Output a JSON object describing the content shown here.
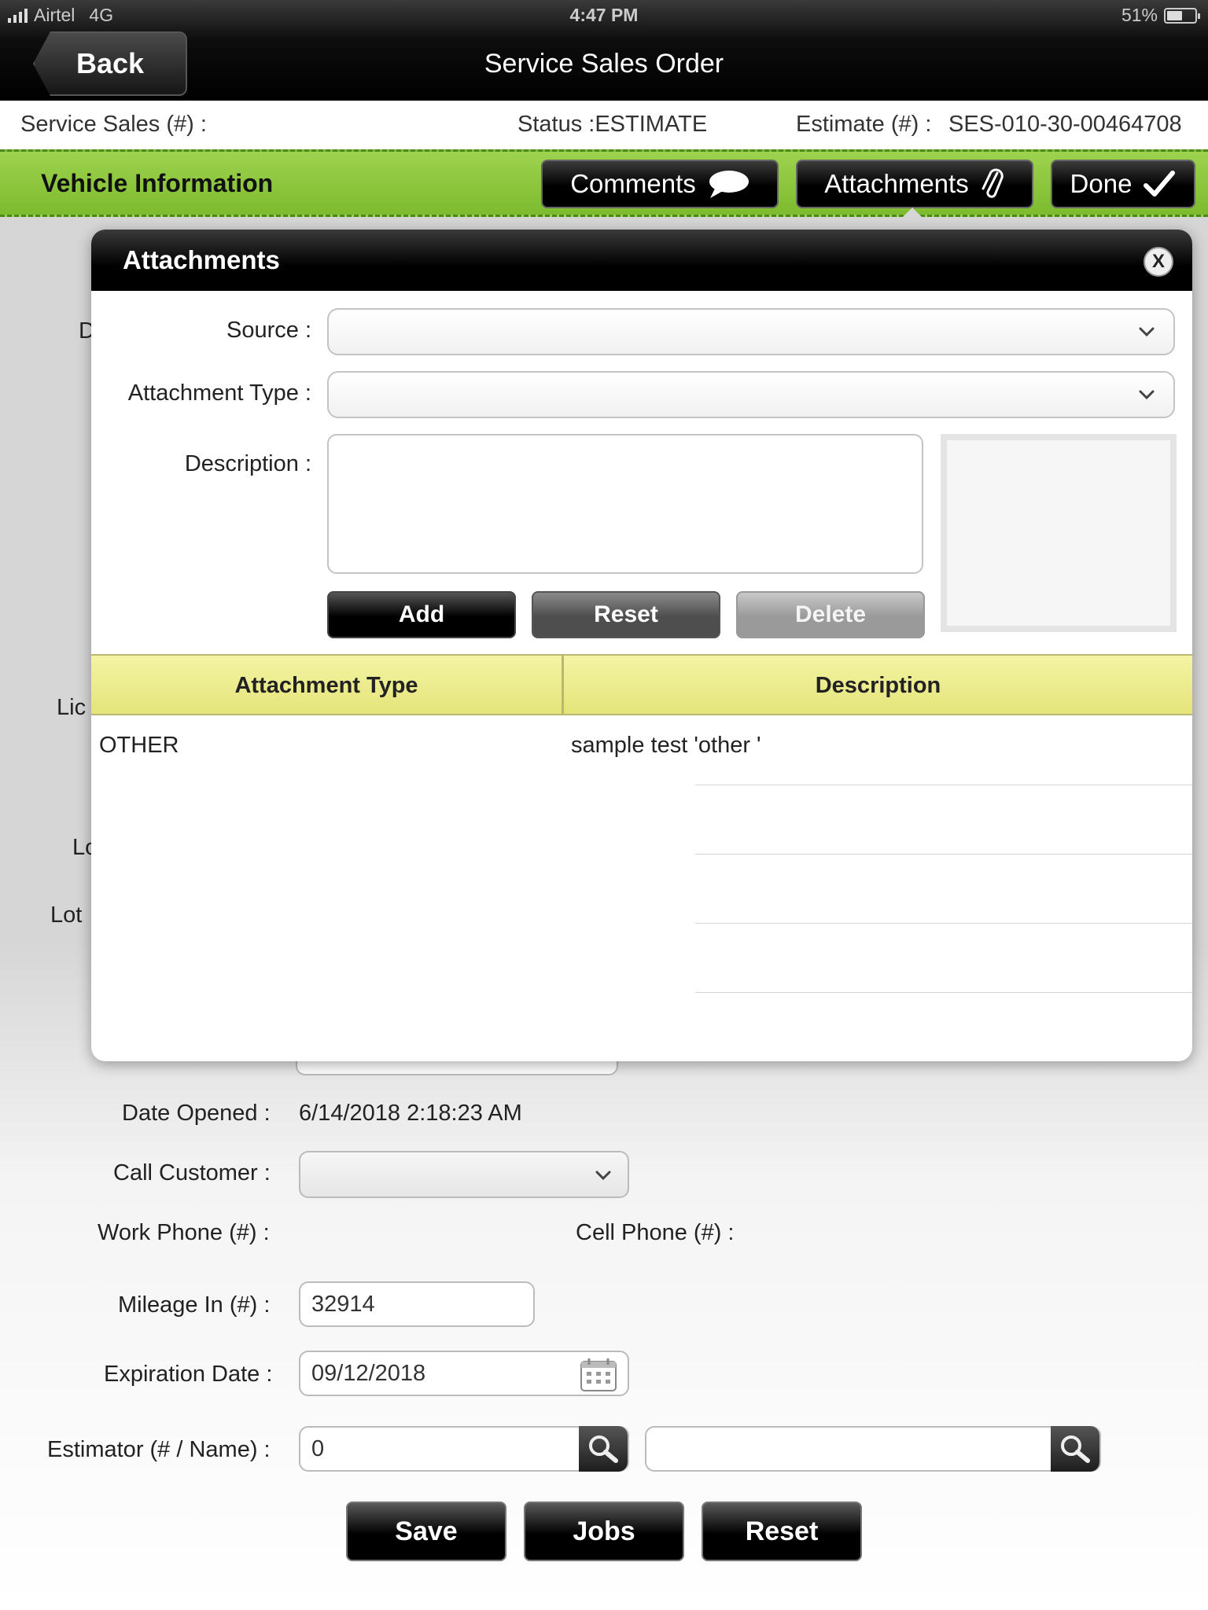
{
  "status_bar": {
    "carrier": "Airtel",
    "network": "4G",
    "time": "4:47 PM",
    "battery": "51%"
  },
  "nav": {
    "back_label": "Back",
    "title": "Service Sales Order"
  },
  "info": {
    "service_sales": "Service Sales (#)  :",
    "status": "Status :ESTIMATE",
    "estimate_label": "Estimate (#) :",
    "estimate_value": "SES-010-30-00464708"
  },
  "toolbar": {
    "section_title": "Vehicle Information",
    "comments_label": "Comments",
    "attachments_label": "Attachments",
    "done_label": "Done"
  },
  "background_form": {
    "partial_labels": [
      "D",
      "Lic",
      "Lo",
      "Lot"
    ],
    "date_opened_label": "Date Opened :",
    "date_opened_value": "6/14/2018 2:18:23 AM",
    "call_customer_label": "Call Customer :",
    "call_customer_value": "",
    "work_phone_label": "Work Phone (#) :",
    "cell_phone_label": "Cell Phone  (#) :",
    "mileage_label": "Mileage In (#) :",
    "mileage_value": "32914",
    "expiration_label": "Expiration Date :",
    "expiration_value": "09/12/2018",
    "estimator_label": "Estimator (# / Name) :",
    "estimator_number": "0",
    "estimator_name": "",
    "buttons": {
      "save": "Save",
      "jobs": "Jobs",
      "reset": "Reset"
    }
  },
  "modal": {
    "title": "Attachments",
    "close": "X",
    "source_label": "Source :",
    "source_value": "",
    "type_label": "Attachment Type :",
    "type_value": "",
    "description_label": "Description :",
    "description_value": "",
    "buttons": {
      "add": "Add",
      "reset": "Reset",
      "delete": "Delete"
    },
    "grid": {
      "columns": [
        "Attachment Type",
        "Description"
      ],
      "rows": [
        {
          "type": "OTHER",
          "description": "sample test 'other '"
        }
      ]
    }
  }
}
